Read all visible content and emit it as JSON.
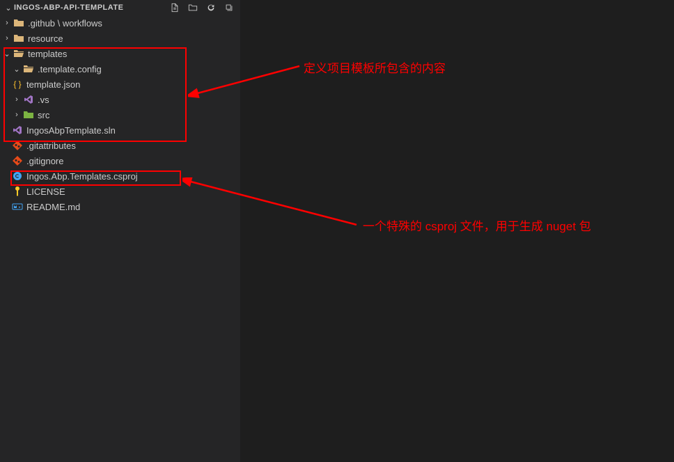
{
  "explorer": {
    "title": "INGOS-ABP-API-TEMPLATE"
  },
  "tree": {
    "github_workflows": ".github \\ workflows",
    "resource": "resource",
    "templates": "templates",
    "template_config": ".template.config",
    "template_json": "template.json",
    "vs": ".vs",
    "src": "src",
    "sln": "IngosAbpTemplate.sln",
    "gitattributes": ".gitattributes",
    "gitignore": ".gitignore",
    "csproj": "Ingos.Abp.Templates.csproj",
    "license": "LICENSE",
    "readme": "README.md"
  },
  "annotations": {
    "note1": "定义项目模板所包含的内容",
    "note2": "一个特殊的 csproj 文件，用于生成 nuget 包"
  }
}
